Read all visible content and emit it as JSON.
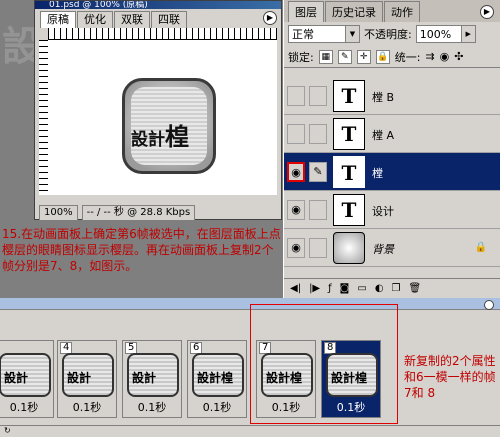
{
  "document": {
    "title": "01.psd @ 100% (原稿)",
    "tabs": [
      "原稿",
      "优化",
      "双联",
      "四联"
    ],
    "zoom": "100%",
    "download_status": "-- / -- 秒 @ 28.8 Kbps",
    "artwork_text": "設計",
    "artwork_glyph": "楻"
  },
  "background_logo": "設計楻",
  "caption_left": "15.在动画面板上确定第6帧被选中，在图层面板上点樱层的眼睛图标显示樱层。再在动画面板上复制2个帧分别是7、8，如图示。",
  "layers_panel": {
    "tabs": [
      "图层",
      "历史记录",
      "动作"
    ],
    "blend_mode": "正常",
    "opacity_label": "不透明度:",
    "opacity_value": "100%",
    "lock_label": "锁定:",
    "unify_label": "统一:",
    "layers": [
      {
        "name": "樘 B",
        "thumb": "T",
        "visible": false,
        "selected": false
      },
      {
        "name": "樘 A",
        "thumb": "T",
        "visible": false,
        "selected": false
      },
      {
        "name": "樘",
        "thumb": "T",
        "visible": true,
        "selected": true
      },
      {
        "name": "设计",
        "thumb": "T",
        "visible": true,
        "selected": false
      },
      {
        "name": "背景",
        "thumb": "",
        "visible": true,
        "selected": false,
        "locked": true
      }
    ]
  },
  "animation_panel": {
    "frames": [
      {
        "number": "",
        "text": "設計",
        "delay": "0.1秒"
      },
      {
        "number": "4",
        "text": "設計",
        "delay": "0.1秒"
      },
      {
        "number": "5",
        "text": "設計",
        "delay": "0.1秒"
      },
      {
        "number": "6",
        "text": "設計楻",
        "delay": "0.1秒"
      },
      {
        "number": "7",
        "text": "設計楻",
        "delay": "0.1秒"
      },
      {
        "number": "8",
        "text": "設計楻",
        "delay": "0.1秒",
        "selected": true
      }
    ]
  },
  "caption_right": "新复制的2个属性和6一模一样的帧 7和 8",
  "colors": {
    "selection": "#0a246a",
    "annotation": "#c00000",
    "panel": "#d6d3ce"
  }
}
